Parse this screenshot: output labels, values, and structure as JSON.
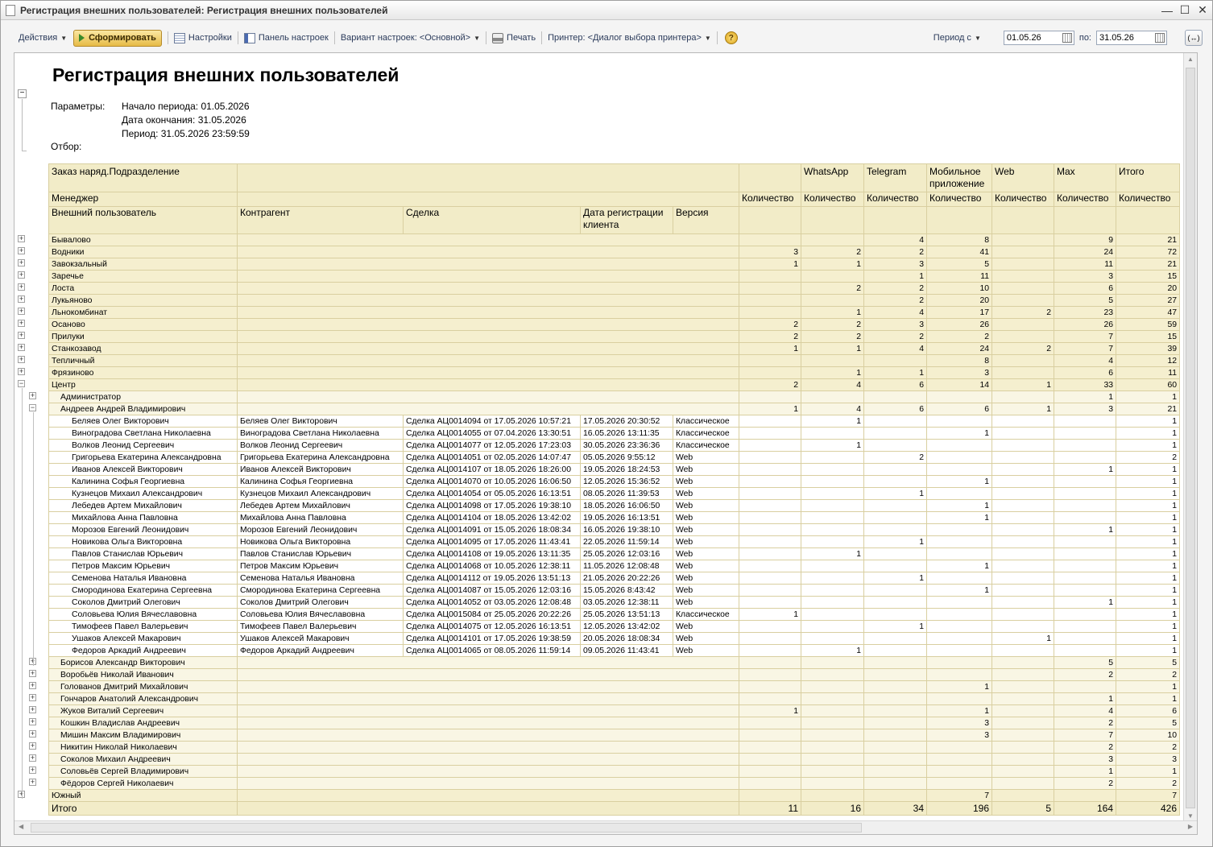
{
  "window": {
    "title": "Регистрация внешних пользователей: Регистрация внешних пользователей"
  },
  "toolbar": {
    "actions": "Действия",
    "generate": "Сформировать",
    "settings": "Настройки",
    "settings_panel": "Панель настроек",
    "variant": "Вариант настроек: <Основной>",
    "print": "Печать",
    "printer": "Принтер: <Диалог выбора принтера>",
    "help": "?",
    "period_label": "Период с",
    "date_from": "01.05.26",
    "to_label": "по:",
    "date_to": "31.05.26",
    "swap": "(↔)"
  },
  "report": {
    "title": "Регистрация внешних пользователей",
    "params_label": "Параметры:",
    "param1": "Начало периода: 01.05.2026",
    "param2": "Дата окончания: 31.05.2026",
    "param3": "Период: 31.05.2026 23:59:59",
    "filter_label": "Отбор:"
  },
  "headers": {
    "h_div": "Заказ наряд.Подразделение",
    "h_mgr": "Менеджер",
    "h_user": "Внешний пользователь",
    "h_contr": "Контрагент",
    "h_deal": "Сделка",
    "h_date": "Дата регистрации клиента",
    "h_ver": "Версия",
    "c_whatsapp": "WhatsApp",
    "c_telegram": "Telegram",
    "c_mobile": "Мобильное приложение",
    "c_web": "Web",
    "c_max": "Max",
    "c_total": "Итого",
    "qty": "Количество"
  },
  "rows": [
    {
      "lvl": 1,
      "exp": "+",
      "name": "Бывалово",
      "v": [
        "",
        "",
        "4",
        "8",
        "",
        "9",
        "21"
      ]
    },
    {
      "lvl": 1,
      "exp": "+",
      "name": "Водники",
      "v": [
        "3",
        "2",
        "2",
        "41",
        "",
        "24",
        "72"
      ]
    },
    {
      "lvl": 1,
      "exp": "+",
      "name": "Завокзальный",
      "v": [
        "1",
        "1",
        "3",
        "5",
        "",
        "11",
        "21"
      ]
    },
    {
      "lvl": 1,
      "exp": "+",
      "name": "Заречье",
      "v": [
        "",
        "",
        "1",
        "11",
        "",
        "3",
        "15"
      ]
    },
    {
      "lvl": 1,
      "exp": "+",
      "name": "Лоста",
      "v": [
        "",
        "2",
        "2",
        "10",
        "",
        "6",
        "20"
      ]
    },
    {
      "lvl": 1,
      "exp": "+",
      "name": "Лукьяново",
      "v": [
        "",
        "",
        "2",
        "20",
        "",
        "5",
        "27"
      ]
    },
    {
      "lvl": 1,
      "exp": "+",
      "name": "Льнокомбинат",
      "v": [
        "",
        "1",
        "4",
        "17",
        "2",
        "23",
        "47"
      ]
    },
    {
      "lvl": 1,
      "exp": "+",
      "name": "Осаново",
      "v": [
        "2",
        "2",
        "3",
        "26",
        "",
        "26",
        "59"
      ]
    },
    {
      "lvl": 1,
      "exp": "+",
      "name": "Прилуки",
      "v": [
        "2",
        "2",
        "2",
        "2",
        "",
        "7",
        "15"
      ]
    },
    {
      "lvl": 1,
      "exp": "+",
      "name": "Станкозавод",
      "v": [
        "1",
        "1",
        "4",
        "24",
        "2",
        "7",
        "39"
      ]
    },
    {
      "lvl": 1,
      "exp": "+",
      "name": "Тепличный",
      "v": [
        "",
        "",
        "",
        "8",
        "",
        "4",
        "12"
      ]
    },
    {
      "lvl": 1,
      "exp": "+",
      "name": "Фрязиново",
      "v": [
        "",
        "1",
        "1",
        "3",
        "",
        "6",
        "11"
      ]
    },
    {
      "lvl": 1,
      "exp": "−",
      "name": "Центр",
      "v": [
        "2",
        "4",
        "6",
        "14",
        "1",
        "33",
        "60"
      ]
    },
    {
      "lvl": 2,
      "exp": "+",
      "name": "Администратор",
      "v": [
        "",
        "",
        "",
        "",
        "",
        "1",
        "1"
      ]
    },
    {
      "lvl": 2,
      "exp": "−",
      "name": "Андреев Андрей Владимирович",
      "v": [
        "1",
        "4",
        "6",
        "6",
        "1",
        "3",
        "21"
      ]
    },
    {
      "lvl": 3,
      "name": "Беляев Олег Викторович",
      "contr": "Беляев Олег Викторович",
      "deal": "Сделка АЦ0014094 от 17.05.2026 10:57:21",
      "date": "17.05.2026 20:30:52",
      "ver": "Классическое",
      "v": [
        "",
        "1",
        "",
        "",
        "",
        "",
        "1"
      ]
    },
    {
      "lvl": 3,
      "name": "Виноградова Светлана Николаевна",
      "contr": "Виноградова Светлана Николаевна",
      "deal": "Сделка АЦ0014055 от 07.04.2026 13:30:51",
      "date": "16.05.2026 13:11:35",
      "ver": "Классическое",
      "v": [
        "",
        "",
        "",
        "1",
        "",
        "",
        "1"
      ]
    },
    {
      "lvl": 3,
      "name": "Волков Леонид Сергеевич",
      "contr": "Волков Леонид Сергеевич",
      "deal": "Сделка АЦ0014077 от 12.05.2026 17:23:03",
      "date": "30.05.2026 23:36:36",
      "ver": "Классическое",
      "v": [
        "",
        "1",
        "",
        "",
        "",
        "",
        "1"
      ]
    },
    {
      "lvl": 3,
      "name": "Григорьева Екатерина Александровна",
      "contr": "Григорьева Екатерина Александровна",
      "deal": "Сделка АЦ0014051 от 02.05.2026 14:07:47",
      "date": "05.05.2026 9:55:12",
      "ver": "Web",
      "v": [
        "",
        "",
        "2",
        "",
        "",
        "",
        "2"
      ]
    },
    {
      "lvl": 3,
      "name": "Иванов Алексей Викторович",
      "contr": "Иванов Алексей Викторович",
      "deal": "Сделка АЦ0014107 от 18.05.2026 18:26:00",
      "date": "19.05.2026 18:24:53",
      "ver": "Web",
      "v": [
        "",
        "",
        "",
        "",
        "",
        "1",
        "1"
      ]
    },
    {
      "lvl": 3,
      "name": "Калинина Софья Георгиевна",
      "contr": "Калинина Софья Георгиевна",
      "deal": "Сделка АЦ0014070 от 10.05.2026 16:06:50",
      "date": "12.05.2026 15:36:52",
      "ver": "Web",
      "v": [
        "",
        "",
        "",
        "1",
        "",
        "",
        "1"
      ]
    },
    {
      "lvl": 3,
      "name": "Кузнецов Михаил Александрович",
      "contr": "Кузнецов Михаил Александрович",
      "deal": "Сделка АЦ0014054 от 05.05.2026 16:13:51",
      "date": "08.05.2026 11:39:53",
      "ver": "Web",
      "v": [
        "",
        "",
        "1",
        "",
        "",
        "",
        "1"
      ]
    },
    {
      "lvl": 3,
      "name": "Лебедев Артем Михайлович",
      "contr": "Лебедев Артем Михайлович",
      "deal": "Сделка АЦ0014098 от 17.05.2026 19:38:10",
      "date": "18.05.2026 16:06:50",
      "ver": "Web",
      "v": [
        "",
        "",
        "",
        "1",
        "",
        "",
        "1"
      ]
    },
    {
      "lvl": 3,
      "name": "Михайлова Анна Павловна",
      "contr": "Михайлова Анна Павловна",
      "deal": "Сделка АЦ0014104 от 18.05.2026 13:42:02",
      "date": "19.05.2026 16:13:51",
      "ver": "Web",
      "v": [
        "",
        "",
        "",
        "1",
        "",
        "",
        "1"
      ]
    },
    {
      "lvl": 3,
      "name": "Морозов Евгений Леонидович",
      "contr": "Морозов Евгений Леонидович",
      "deal": "Сделка АЦ0014091 от 15.05.2026 18:08:34",
      "date": "16.05.2026 19:38:10",
      "ver": "Web",
      "v": [
        "",
        "",
        "",
        "",
        "",
        "1",
        "1"
      ]
    },
    {
      "lvl": 3,
      "name": "Новикова Ольга Викторовна",
      "contr": "Новикова Ольга Викторовна",
      "deal": "Сделка АЦ0014095 от 17.05.2026 11:43:41",
      "date": "22.05.2026 11:59:14",
      "ver": "Web",
      "v": [
        "",
        "",
        "1",
        "",
        "",
        "",
        "1"
      ]
    },
    {
      "lvl": 3,
      "name": "Павлов Станислав Юрьевич",
      "contr": "Павлов Станислав Юрьевич",
      "deal": "Сделка АЦ0014108 от 19.05.2026 13:11:35",
      "date": "25.05.2026 12:03:16",
      "ver": "Web",
      "v": [
        "",
        "1",
        "",
        "",
        "",
        "",
        "1"
      ]
    },
    {
      "lvl": 3,
      "name": "Петров Максим Юрьевич",
      "contr": "Петров Максим Юрьевич",
      "deal": "Сделка АЦ0014068 от 10.05.2026 12:38:11",
      "date": "11.05.2026 12:08:48",
      "ver": "Web",
      "v": [
        "",
        "",
        "",
        "1",
        "",
        "",
        "1"
      ]
    },
    {
      "lvl": 3,
      "name": "Семенова Наталья Ивановна",
      "contr": "Семенова Наталья Ивановна",
      "deal": "Сделка АЦ0014112 от 19.05.2026 13:51:13",
      "date": "21.05.2026 20:22:26",
      "ver": "Web",
      "v": [
        "",
        "",
        "1",
        "",
        "",
        "",
        "1"
      ]
    },
    {
      "lvl": 3,
      "name": "Смородинова Екатерина Сергеевна",
      "contr": "Смородинова Екатерина Сергеевна",
      "deal": "Сделка АЦ0014087 от 15.05.2026 12:03:16",
      "date": "15.05.2026 8:43:42",
      "ver": "Web",
      "v": [
        "",
        "",
        "",
        "1",
        "",
        "",
        "1"
      ]
    },
    {
      "lvl": 3,
      "name": "Соколов Дмитрий Олегович",
      "contr": "Соколов Дмитрий Олегович",
      "deal": "Сделка АЦ0014052 от 03.05.2026 12:08:48",
      "date": "03.05.2026 12:38:11",
      "ver": "Web",
      "v": [
        "",
        "",
        "",
        "",
        "",
        "1",
        "1"
      ]
    },
    {
      "lvl": 3,
      "name": "Соловьева Юлия Вячеславовна",
      "contr": "Соловьева Юлия Вячеславовна",
      "deal": "Сделка АЦ0015084 от 25.05.2026 20:22:26",
      "date": "25.05.2026 13:51:13",
      "ver": "Классическое",
      "v": [
        "1",
        "",
        "",
        "",
        "",
        "",
        "1"
      ]
    },
    {
      "lvl": 3,
      "name": "Тимофеев Павел Валерьевич",
      "contr": "Тимофеев Павел Валерьевич",
      "deal": "Сделка АЦ0014075 от 12.05.2026 16:13:51",
      "date": "12.05.2026 13:42:02",
      "ver": "Web",
      "v": [
        "",
        "",
        "1",
        "",
        "",
        "",
        "1"
      ]
    },
    {
      "lvl": 3,
      "name": "Ушаков Алексей Макарович",
      "contr": "Ушаков Алексей Макарович",
      "deal": "Сделка АЦ0014101 от 17.05.2026 19:38:59",
      "date": "20.05.2026 18:08:34",
      "ver": "Web",
      "v": [
        "",
        "",
        "",
        "",
        "1",
        "",
        "1"
      ]
    },
    {
      "lvl": 3,
      "name": "Федоров Аркадий Андреевич",
      "contr": "Федоров Аркадий Андреевич",
      "deal": "Сделка АЦ0014065 от 08.05.2026 11:59:14",
      "date": "09.05.2026 11:43:41",
      "ver": "Web",
      "v": [
        "",
        "1",
        "",
        "",
        "",
        "",
        "1"
      ]
    },
    {
      "lvl": 2,
      "exp": "+",
      "name": "Борисов Александр Викторович",
      "v": [
        "",
        "",
        "",
        "",
        "",
        "5",
        "5"
      ]
    },
    {
      "lvl": 2,
      "exp": "+",
      "name": "Воробьёв Николай Иванович",
      "v": [
        "",
        "",
        "",
        "",
        "",
        "2",
        "2"
      ]
    },
    {
      "lvl": 2,
      "exp": "+",
      "name": "Голованов Дмитрий Михайлович",
      "v": [
        "",
        "",
        "",
        "1",
        "",
        "",
        "1"
      ]
    },
    {
      "lvl": 2,
      "exp": "+",
      "name": "Гончаров Анатолий Александрович",
      "v": [
        "",
        "",
        "",
        "",
        "",
        "1",
        "1"
      ]
    },
    {
      "lvl": 2,
      "exp": "+",
      "name": "Жуков Виталий Сергеевич",
      "v": [
        "1",
        "",
        "",
        "1",
        "",
        "4",
        "6"
      ]
    },
    {
      "lvl": 2,
      "exp": "+",
      "name": "Кошкин Владислав Андреевич",
      "v": [
        "",
        "",
        "",
        "3",
        "",
        "2",
        "5"
      ]
    },
    {
      "lvl": 2,
      "exp": "+",
      "name": "Мишин Максим Владимирович",
      "v": [
        "",
        "",
        "",
        "3",
        "",
        "7",
        "10"
      ]
    },
    {
      "lvl": 2,
      "exp": "+",
      "name": "Никитин Николай Николаевич",
      "v": [
        "",
        "",
        "",
        "",
        "",
        "2",
        "2"
      ]
    },
    {
      "lvl": 2,
      "exp": "+",
      "name": "Соколов Михаил Андреевич",
      "v": [
        "",
        "",
        "",
        "",
        "",
        "3",
        "3"
      ]
    },
    {
      "lvl": 2,
      "exp": "+",
      "name": "Соловьёв Сергей Владимирович",
      "v": [
        "",
        "",
        "",
        "",
        "",
        "1",
        "1"
      ]
    },
    {
      "lvl": 2,
      "exp": "+",
      "name": "Фёдоров Сергей Николаевич",
      "v": [
        "",
        "",
        "",
        "",
        "",
        "2",
        "2"
      ]
    },
    {
      "lvl": 1,
      "exp": "+",
      "name": "Южный",
      "v": [
        "",
        "",
        "",
        "7",
        "",
        "",
        "7"
      ]
    }
  ],
  "total": {
    "label": "Итого",
    "v": [
      "11",
      "16",
      "34",
      "196",
      "5",
      "164",
      "426"
    ]
  }
}
